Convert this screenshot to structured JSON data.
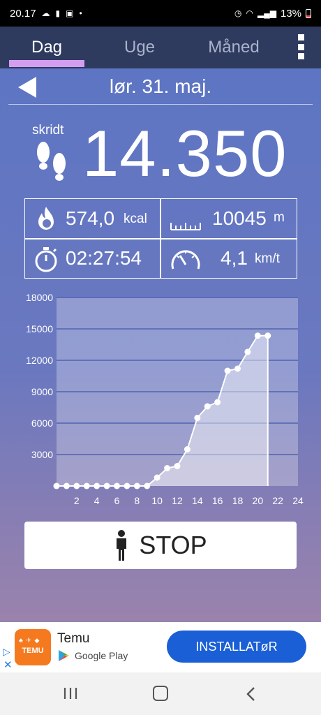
{
  "status_bar": {
    "time": "20.17",
    "battery": "13%"
  },
  "tabs": [
    {
      "label": "Dag",
      "active": true
    },
    {
      "label": "Uge",
      "active": false
    },
    {
      "label": "Måned",
      "active": false
    }
  ],
  "day": {
    "date": "lør. 31. maj.",
    "steps_label": "skridt",
    "steps": "14.350"
  },
  "stats": {
    "calories": "574,0",
    "calories_unit": "kcal",
    "distance": "10045",
    "distance_unit": "m",
    "duration": "02:27:54",
    "speed": "4,1",
    "speed_unit": "km/t"
  },
  "icons": {
    "back": "back-arrow-icon",
    "footsteps": "footsteps-icon",
    "calories": "flame-icon",
    "distance": "ruler-icon",
    "duration": "stopwatch-icon",
    "speed": "speedometer-icon",
    "stop": "person-icon"
  },
  "chart_data": {
    "type": "area",
    "x": [
      0,
      1,
      2,
      3,
      4,
      5,
      6,
      7,
      8,
      9,
      10,
      11,
      12,
      13,
      14,
      15,
      16,
      17,
      18,
      19,
      20,
      21
    ],
    "series": [
      {
        "values": [
          0,
          0,
          0,
          0,
          0,
          0,
          0,
          0,
          0,
          0,
          800,
          1700,
          1900,
          3500,
          6500,
          7600,
          8000,
          11000,
          11200,
          12800,
          14350,
          14350
        ]
      }
    ],
    "x_ticks": [
      "2",
      "4",
      "6",
      "8",
      "10",
      "12",
      "14",
      "16",
      "18",
      "20",
      "22",
      "24"
    ],
    "x_tick_values": [
      2,
      4,
      6,
      8,
      10,
      12,
      14,
      16,
      18,
      20,
      22,
      24
    ],
    "y_ticks": [
      "3000",
      "6000",
      "9000",
      "12000",
      "15000",
      "18000"
    ],
    "y_tick_values": [
      3000,
      6000,
      9000,
      12000,
      15000,
      18000
    ],
    "xlim": [
      0,
      24
    ],
    "ylim": [
      0,
      18000
    ],
    "grid": true
  },
  "stop_button": {
    "label": "STOP"
  },
  "ad": {
    "app_name": "Temu",
    "logo_text": "TEMU",
    "store": "Google Play",
    "install_label": "INSTALLATøR"
  },
  "colors": {
    "tab_bar": "#2e3a5e",
    "tab_indicator": "#d39ef0",
    "background_top": "#5d75c3",
    "background_bottom": "#9a83ac",
    "install_button": "#1a5fd6",
    "temu_orange": "#f57a1f"
  }
}
